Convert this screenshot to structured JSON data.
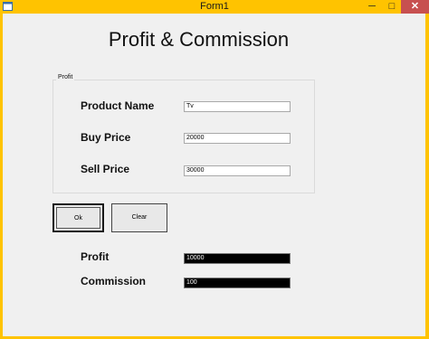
{
  "window": {
    "title": "Form1",
    "minimize_glyph": "─",
    "maximize_glyph": "□",
    "close_glyph": "✕"
  },
  "page": {
    "title": "Profit & Commission"
  },
  "group": {
    "legend": "Profit"
  },
  "form": {
    "product_name": {
      "label": "Product Name",
      "value": "Tv"
    },
    "buy_price": {
      "label": "Buy Price",
      "value": "20000"
    },
    "sell_price": {
      "label": "Sell Price",
      "value": "30000"
    }
  },
  "buttons": {
    "ok": "Ok",
    "clear": "Clear"
  },
  "results": {
    "profit": {
      "label": "Profit",
      "value": "10000"
    },
    "commission": {
      "label": "Commission",
      "value": "100"
    }
  },
  "colors": {
    "titlebar": "#ffc300",
    "close_button": "#c75050",
    "client_background": "#f0f0f0",
    "result_box_background": "#000000"
  }
}
